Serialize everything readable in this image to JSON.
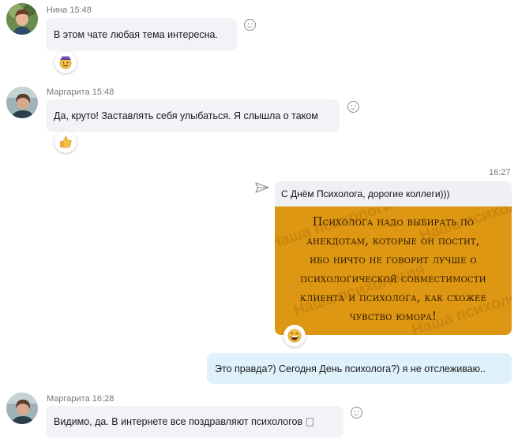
{
  "messages": [
    {
      "author": "Нина",
      "time": "15:48",
      "text": "В этом чате любая тема интересна.",
      "reaction": "smiling-face-with-hat"
    },
    {
      "author": "Маргарита",
      "time": "15:48",
      "text": "Да, круто! Заставлять себя улыбаться. Я слышла о таком",
      "reaction": "thumbs-up"
    },
    {
      "time": "16:27",
      "caption": "С Днём Психолога, дорогие коллеги)))",
      "image_lines": [
        "Психолога надо выбирать по",
        "анекдотам, которые он постит,",
        "ибо ничто не говорит лучше о",
        "психологической совместимости",
        "клиента и психолога, как схожее",
        "чувство юмора!"
      ],
      "watermark": "Наша психология",
      "reaction": "laughing-face"
    },
    {
      "text": "Это правда?) Сегодня День психолога?) я не отслеживаю.."
    },
    {
      "author": "Маргарита",
      "time": "16:28",
      "text": "Видимо, да. В интернете все поздравляют психологов"
    }
  ],
  "colors": {
    "incoming_bubble": "#f1f3f6",
    "outgoing_bubble": "#dff1fb",
    "image_background": "#dd9713"
  }
}
